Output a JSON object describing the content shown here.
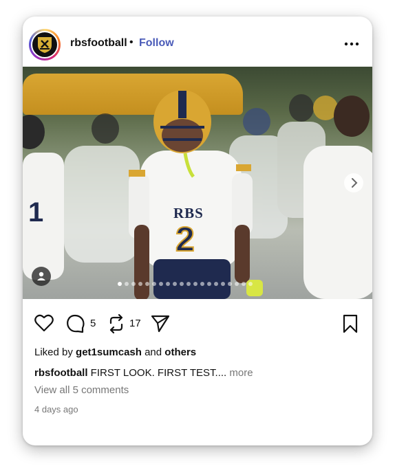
{
  "post": {
    "username": "rbsfootball",
    "separator": "•",
    "follow_label": "Follow",
    "carousel": {
      "total_slides": 20,
      "active_index": 0
    },
    "actions": {
      "comment_count": "5",
      "repost_count": "17"
    },
    "liked_by": {
      "prefix": "Liked by",
      "user": "get1sumcash",
      "conjunction": "and",
      "others": "others"
    },
    "caption": {
      "username": "rbsfootball",
      "text": "FIRST LOOK. FIRST TEST....",
      "more_label": "more"
    },
    "view_comments": "View all 5 comments",
    "timestamp": "4 days ago",
    "jersey": {
      "text": "RBS",
      "number": "2"
    }
  },
  "icons": {
    "more": "more-horizontal-icon",
    "like": "heart-icon",
    "comment": "comment-icon",
    "repost": "repost-icon",
    "share": "send-icon",
    "save": "bookmark-icon",
    "next": "chevron-right-icon",
    "tag": "user-tag-icon"
  },
  "colors": {
    "follow": "#4a5bb8",
    "jersey_gold": "#d9a632",
    "jersey_navy": "#1f2a4f"
  }
}
